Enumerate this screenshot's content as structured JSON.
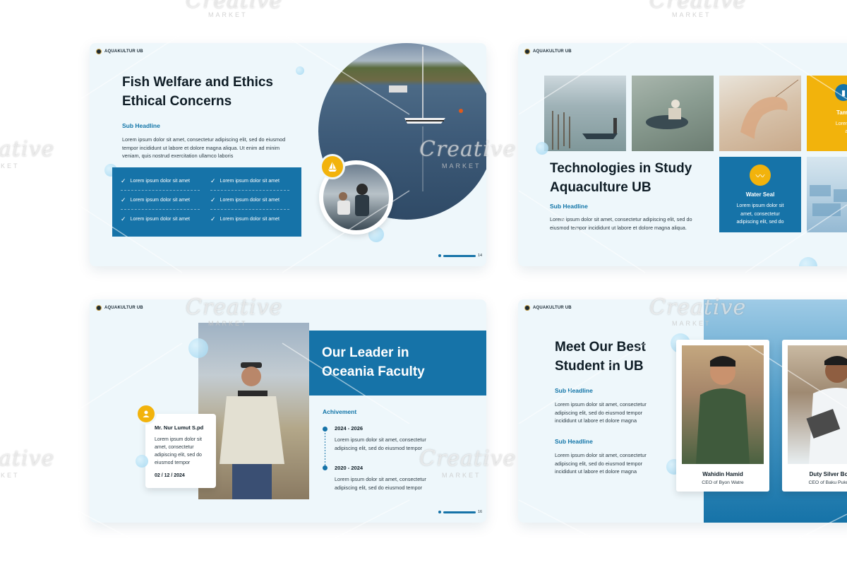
{
  "slide1": {
    "brand": "AQUAKULTUR UB",
    "title_line1": "Fish Welfare and Ethics",
    "title_line2": "Ethical Concerns",
    "sub_headline": "Sub Headline",
    "paragraph": "Lorem ipsum dolor sit amet, consectetur adipiscing elit, sed do eiusmod tempor incididunt ut labore et dolore magna aliqua. Ut enim ad minim veniam, quis nostrud exercitation ullamco laboris",
    "checklist": [
      "Lorem ipsum dolor sit amet",
      "Lorem ipsum dolor sit amet",
      "Lorem ipsum dolor sit amet",
      "Lorem ipsum dolor sit amet",
      "Lorem ipsum dolor sit amet",
      "Lorem ipsum dolor sit amet"
    ],
    "page_number": "14"
  },
  "slide2": {
    "brand": "AQUAKULTUR UB",
    "title_line1": "Technologies in Study",
    "title_line2": "Aquaculture UB",
    "sub_headline": "Sub Headline",
    "paragraph": "Lorem ipsum dolor sit amet, consectetur adipiscing elit, sed do eiusmod tempor incididunt ut labore et dolore magna aliqua.",
    "card_water_title": "Water Seal",
    "card_water_text": "Lorem ipsum dolor sit amet, consectetur adipiscing elit, sed do",
    "card_tamba_title": "Tamba",
    "card_tamba_text": "Lorem ipsu ame adipisci"
  },
  "slide3": {
    "brand": "AQUAKULTUR UB",
    "title_line1": "Our Leader in",
    "title_line2": "Oceania Faculty",
    "person_name": "Mr. Nur Lumut S.pd",
    "person_text": "Lorem ipsum dolor sit amet, consectetur adipiscing elit, sed do eiusmod tempor",
    "person_date": "02 / 12 / 2024",
    "achievement_label": "Achivement",
    "timeline": [
      {
        "period": "2024 - 2026",
        "text": "Lorem ipsum dolor sit amet, consectetur adipiscing elit, sed do eiusmod tempor"
      },
      {
        "period": "2020 - 2024",
        "text": "Lorem ipsum dolor sit amet, consectetur adipiscing elit, sed do eiusmod tempor"
      }
    ],
    "page_number": "16"
  },
  "slide4": {
    "brand": "AQUAKULTUR UB",
    "title_line1": "Meet Our Best",
    "title_line2": "Student in UB",
    "sub_headline_1": "Sub Headline",
    "paragraph_1": "Lorem ipsum dolor sit amet, consectetur adipiscing elit, sed do eiusmod tempor incididunt ut labore et dolore magna",
    "sub_headline_2": "Sub Headline",
    "paragraph_2": "Lorem ipsum dolor sit amet, consectetur adipiscing elit, sed do eiusmod tempor incididunt ut labore et dolore magna",
    "students": [
      {
        "name": "Wahidin Hamid",
        "role": "CEO of Byon Watre"
      },
      {
        "name": "Duty Silver Bo",
        "role": "CEO of Baku Puku"
      }
    ]
  },
  "watermark": {
    "word": "Creative",
    "sub": "MARKET"
  },
  "colors": {
    "primary": "#1673a8",
    "accent": "#f2b30c",
    "slide_bg": "#eef7fb"
  },
  "icons": {
    "check": "check-icon",
    "sailboat": "sailboat-icon",
    "user": "user-icon",
    "wave": "wave-icon",
    "building": "building-icon"
  }
}
